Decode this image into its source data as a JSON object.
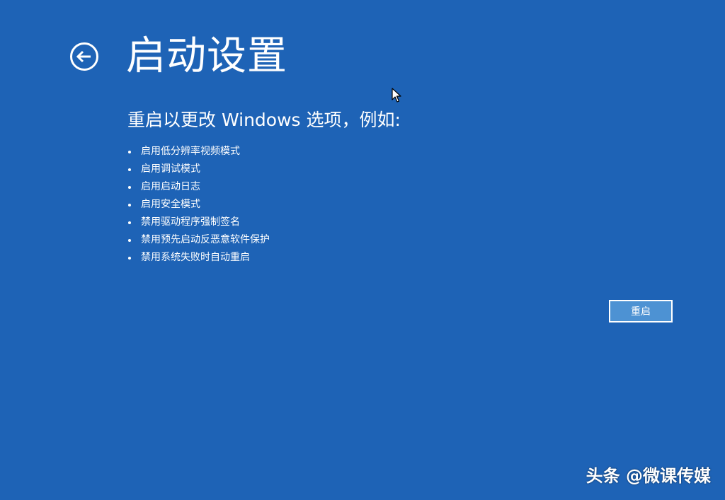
{
  "header": {
    "title": "启动设置",
    "back_icon": "back-arrow-circle-icon"
  },
  "main": {
    "subtitle": "重启以更改 Windows 选项，例如:",
    "options": [
      "启用低分辨率视频模式",
      "启用调试模式",
      "启用启动日志",
      "启用安全模式",
      "禁用驱动程序强制签名",
      "禁用预先启动反恶意软件保护",
      "禁用系统失败时自动重启"
    ],
    "restart_label": "重启"
  },
  "watermark": "头条 @微课传媒",
  "colors": {
    "background": "#1e63b6",
    "button_fill": "#4d92d3",
    "text": "#ffffff"
  }
}
